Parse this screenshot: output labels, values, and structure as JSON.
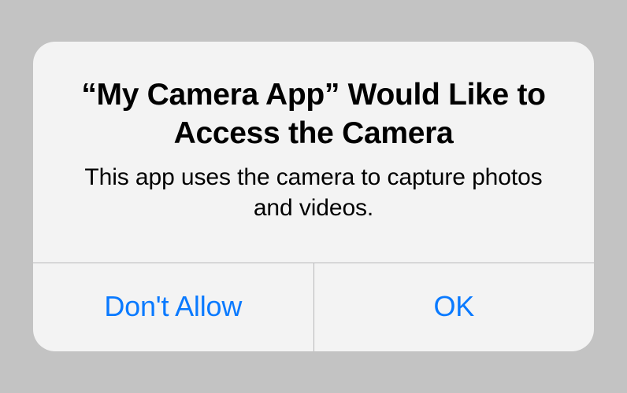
{
  "alert": {
    "title": "“My Camera App” Would Like to Access the Camera",
    "message": "This app uses the camera to capture photos and videos.",
    "buttons": {
      "deny": "Don't Allow",
      "allow": "OK"
    }
  }
}
